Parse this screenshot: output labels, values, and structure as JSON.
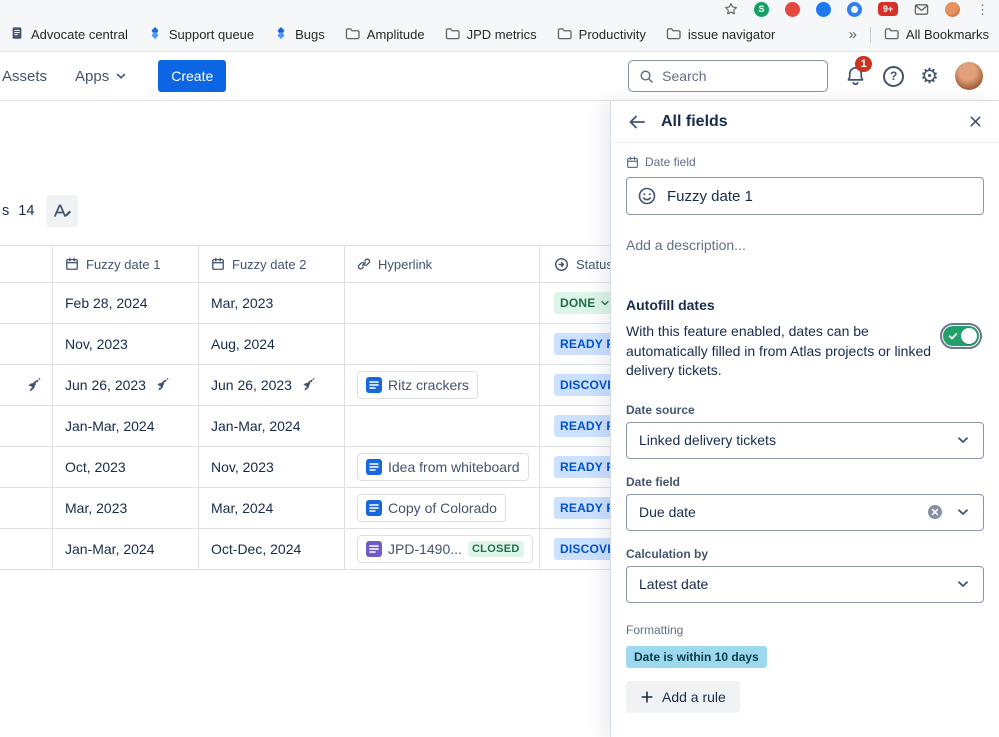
{
  "browser": {
    "extensions": {
      "s_badge": "S",
      "count_badge": "9+"
    },
    "bookmarks": [
      {
        "label": "Advocate central"
      },
      {
        "label": "Support queue"
      },
      {
        "label": "Bugs"
      },
      {
        "label": "Amplitude"
      },
      {
        "label": "JPD metrics"
      },
      {
        "label": "Productivity"
      },
      {
        "label": "issue navigator"
      }
    ],
    "overflow_chevron": "»",
    "all_bookmarks": "All Bookmarks"
  },
  "icons": {
    "gear": "⚙",
    "help": "?",
    "menu_dots": "⋮"
  },
  "app_header": {
    "assets": "Assets",
    "apps": "Apps",
    "create": "Create",
    "search_placeholder": "Search",
    "notifications_badge": "1"
  },
  "fields_toolbar": {
    "partial": "s",
    "count": "14"
  },
  "table": {
    "headers": [
      "Fuzzy date 1",
      "Fuzzy date 2",
      "Hyperlink",
      "Status"
    ],
    "rows": [
      {
        "date1": "Feb 28, 2024",
        "date2": "Mar, 2023",
        "status": "DONE"
      },
      {
        "date1": "Nov, 2023",
        "date2": "Aug, 2024",
        "status": "READY FO"
      },
      {
        "date1": "Jun 26, 2023",
        "date2": "Jun 26, 2023",
        "link": "Ritz crackers",
        "status": "DISCOVE"
      },
      {
        "date1": "Jan-Mar, 2024",
        "date2": "Jan-Mar, 2024",
        "status": "READY FO"
      },
      {
        "date1": "Oct, 2023",
        "date2": "Nov, 2023",
        "link": "Idea from whiteboard",
        "status": "READY FO"
      },
      {
        "date1": "Mar, 2023",
        "date2": "Mar, 2024",
        "link": "Copy of Colorado",
        "status": "READY FO"
      },
      {
        "date1": "Jan-Mar, 2024",
        "date2": "Oct-Dec, 2024",
        "link": "JPD-1490...",
        "link_badge": "CLOSED",
        "status": "DISCOVE"
      }
    ]
  },
  "panel": {
    "title": "All fields",
    "field_type": "Date field",
    "field_name": "Fuzzy date 1",
    "description_placeholder": "Add a description...",
    "autofill_heading": "Autofill dates",
    "autofill_description": "With this feature enabled, dates can be automatically filled in from Atlas projects or linked delivery tickets.",
    "date_source_label": "Date source",
    "date_source_value": "Linked delivery tickets",
    "date_field_label": "Date field",
    "date_field_value": "Due date",
    "calculation_label": "Calculation by",
    "calculation_value": "Latest date",
    "formatting_label": "Formatting",
    "formatting_rule": "Date is within 10 days",
    "add_rule_label": "Add a rule"
  },
  "colors": {
    "accent_blue": "#0C66E4",
    "toggle_green": "#22A06B",
    "status_green_text": "#216E4E",
    "status_blue_text": "#0052CC",
    "rule_badge_bg": "#9DD9EE",
    "notification_red": "#CA3521"
  }
}
